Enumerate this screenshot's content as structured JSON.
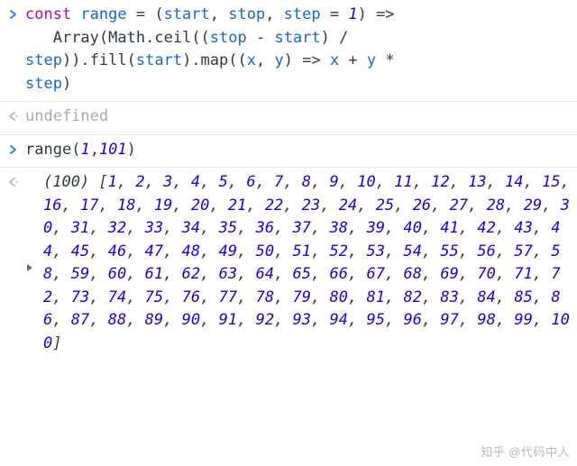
{
  "rows": [
    {
      "kind": "input",
      "code_tokens": [
        {
          "t": "const ",
          "c": "kw"
        },
        {
          "t": "range ",
          "c": "var"
        },
        {
          "t": "= (",
          "c": "op"
        },
        {
          "t": "start",
          "c": "var"
        },
        {
          "t": ", ",
          "c": "op"
        },
        {
          "t": "stop",
          "c": "var"
        },
        {
          "t": ", ",
          "c": "op"
        },
        {
          "t": "step ",
          "c": "var"
        },
        {
          "t": "= ",
          "c": "op"
        },
        {
          "t": "1",
          "c": "num"
        },
        {
          "t": ") =>",
          "c": "op"
        },
        {
          "t": "\n   ",
          "c": "op"
        },
        {
          "t": "Array",
          "c": "fn"
        },
        {
          "t": "(",
          "c": "op"
        },
        {
          "t": "Math",
          "c": "fn"
        },
        {
          "t": ".",
          "c": "op"
        },
        {
          "t": "ceil",
          "c": "fn"
        },
        {
          "t": "((",
          "c": "op"
        },
        {
          "t": "stop ",
          "c": "var"
        },
        {
          "t": "- ",
          "c": "op"
        },
        {
          "t": "start",
          "c": "var"
        },
        {
          "t": ") / ",
          "c": "op"
        },
        {
          "t": "\n",
          "c": "op"
        },
        {
          "t": "step",
          "c": "var"
        },
        {
          "t": ")).",
          "c": "op"
        },
        {
          "t": "fill",
          "c": "fn"
        },
        {
          "t": "(",
          "c": "op"
        },
        {
          "t": "start",
          "c": "var"
        },
        {
          "t": ").",
          "c": "op"
        },
        {
          "t": "map",
          "c": "fn"
        },
        {
          "t": "((",
          "c": "op"
        },
        {
          "t": "x",
          "c": "var"
        },
        {
          "t": ", ",
          "c": "op"
        },
        {
          "t": "y",
          "c": "var"
        },
        {
          "t": ") => ",
          "c": "op"
        },
        {
          "t": "x ",
          "c": "var"
        },
        {
          "t": "+ ",
          "c": "op"
        },
        {
          "t": "y ",
          "c": "var"
        },
        {
          "t": "* ",
          "c": "op"
        },
        {
          "t": "\n",
          "c": "op"
        },
        {
          "t": "step",
          "c": "var"
        },
        {
          "t": ")",
          "c": "op"
        }
      ]
    },
    {
      "kind": "output-undef",
      "text": "undefined"
    },
    {
      "kind": "input",
      "code_tokens": [
        {
          "t": "range",
          "c": "fn"
        },
        {
          "t": "(",
          "c": "op"
        },
        {
          "t": "1",
          "c": "num"
        },
        {
          "t": ",",
          "c": "op"
        },
        {
          "t": "101",
          "c": "num"
        },
        {
          "t": ")",
          "c": "op"
        }
      ]
    },
    {
      "kind": "output-array",
      "length_label": "(100) ",
      "values": [
        1,
        2,
        3,
        4,
        5,
        6,
        7,
        8,
        9,
        10,
        11,
        12,
        13,
        14,
        15,
        16,
        17,
        18,
        19,
        20,
        21,
        22,
        23,
        24,
        25,
        26,
        27,
        28,
        29,
        30,
        31,
        32,
        33,
        34,
        35,
        36,
        37,
        38,
        39,
        40,
        41,
        42,
        43,
        44,
        45,
        46,
        47,
        48,
        49,
        50,
        51,
        52,
        53,
        54,
        55,
        56,
        57,
        58,
        59,
        60,
        61,
        62,
        63,
        64,
        65,
        66,
        67,
        68,
        69,
        70,
        71,
        72,
        73,
        74,
        75,
        76,
        77,
        78,
        79,
        80,
        81,
        82,
        83,
        84,
        85,
        86,
        87,
        88,
        89,
        90,
        91,
        92,
        93,
        94,
        95,
        96,
        97,
        98,
        99,
        100
      ]
    }
  ],
  "watermark": "知乎 @代码中人"
}
